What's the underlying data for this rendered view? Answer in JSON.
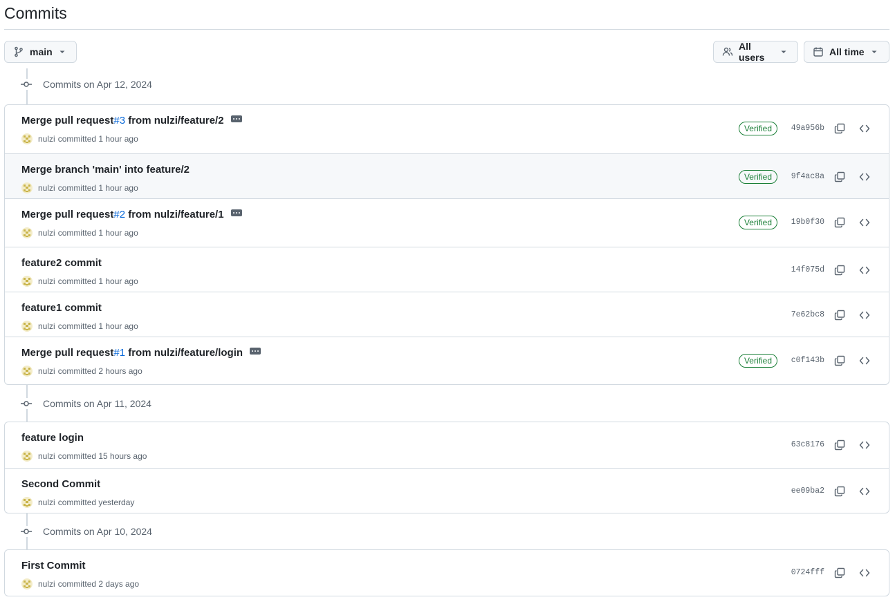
{
  "page": {
    "title": "Commits"
  },
  "toolbar": {
    "branch": {
      "label": "main",
      "icon": "git-branch-icon"
    },
    "users": {
      "label": "All users",
      "icon": "people-icon"
    },
    "time": {
      "label": "All time",
      "icon": "calendar-icon"
    }
  },
  "colors": {
    "link": "#0969da",
    "verified": "#1a7f37",
    "border": "#d1d9e0",
    "muted": "#59636e"
  },
  "groups": [
    {
      "date_label": "Commits on Apr 12, 2024",
      "commits": [
        {
          "message_prefix": "Merge pull request ",
          "pr": "#3",
          "message_suffix": " from nulzi/feature/2",
          "has_ellipsis": true,
          "author": "nulzi",
          "time": "committed 1 hour ago",
          "verified": "Verified",
          "sha": "49a956b"
        },
        {
          "message_prefix": "Merge branch 'main' into feature/2",
          "pr": "",
          "message_suffix": "",
          "has_ellipsis": false,
          "author": "nulzi",
          "time": "committed 1 hour ago",
          "verified": "Verified",
          "sha": "9f4ac8a"
        },
        {
          "message_prefix": "Merge pull request ",
          "pr": "#2",
          "message_suffix": " from nulzi/feature/1",
          "has_ellipsis": true,
          "author": "nulzi",
          "time": "committed 1 hour ago",
          "verified": "Verified",
          "sha": "19b0f30"
        },
        {
          "message_prefix": "feature2 commit",
          "pr": "",
          "message_suffix": "",
          "has_ellipsis": false,
          "author": "nulzi",
          "time": "committed 1 hour ago",
          "verified": "",
          "sha": "14f075d"
        },
        {
          "message_prefix": "feature1 commit",
          "pr": "",
          "message_suffix": "",
          "has_ellipsis": false,
          "author": "nulzi",
          "time": "committed 1 hour ago",
          "verified": "",
          "sha": "7e62bc8"
        },
        {
          "message_prefix": "Merge pull request ",
          "pr": "#1",
          "message_suffix": " from nulzi/feature/login",
          "has_ellipsis": true,
          "author": "nulzi",
          "time": "committed 2 hours ago",
          "verified": "Verified",
          "sha": "c0f143b"
        }
      ]
    },
    {
      "date_label": "Commits on Apr 11, 2024",
      "commits": [
        {
          "message_prefix": "feature login",
          "pr": "",
          "message_suffix": "",
          "has_ellipsis": false,
          "author": "nulzi",
          "time": "committed 15 hours ago",
          "verified": "",
          "sha": "63c8176"
        },
        {
          "message_prefix": "Second Commit",
          "pr": "",
          "message_suffix": "",
          "has_ellipsis": false,
          "author": "nulzi",
          "time": "committed yesterday",
          "verified": "",
          "sha": "ee09ba2"
        }
      ]
    },
    {
      "date_label": "Commits on Apr 10, 2024",
      "commits": [
        {
          "message_prefix": "First Commit",
          "pr": "",
          "message_suffix": "",
          "has_ellipsis": false,
          "author": "nulzi",
          "time": "committed 2 days ago",
          "verified": "",
          "sha": "0724fff"
        }
      ]
    }
  ]
}
